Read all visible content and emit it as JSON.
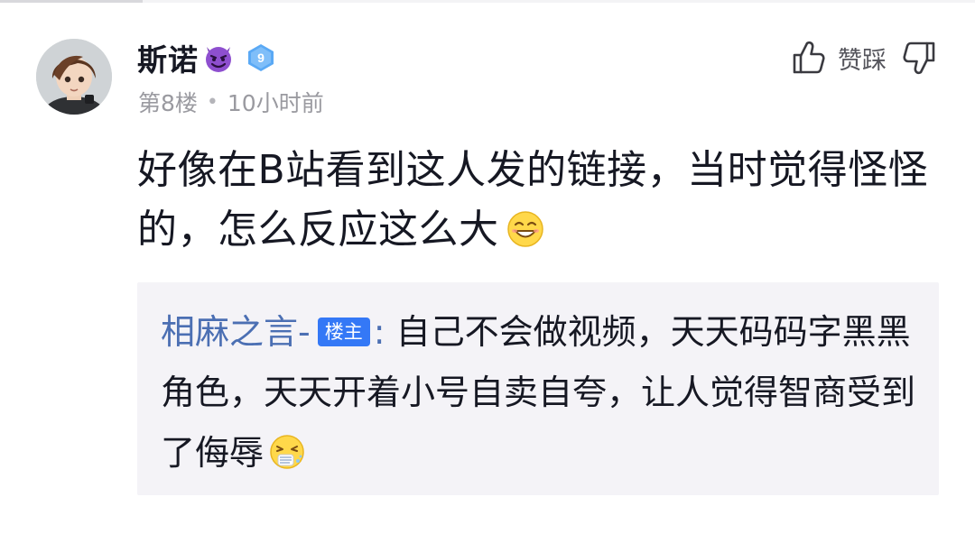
{
  "comment": {
    "username": "斯诺",
    "username_emoji": "devil-emoji-icon",
    "level": "9",
    "floor": "第8楼",
    "separator": "•",
    "time": "10小时前",
    "text": "好像在B站看到这人发的链接，当时觉得怪怪的，怎么反应这么大",
    "text_emoji": "laughing-emoji-icon"
  },
  "actions": {
    "like_icon": "thumbs-up-icon",
    "label": "赞踩",
    "dislike_icon": "thumbs-down-icon"
  },
  "reply": {
    "username": "相麻之言-",
    "owner_badge": "楼主",
    "colon": ":",
    "text": " 自己不会做视频，天天码码字黑黑角色，天天开着小号自卖自夸，让人觉得智商受到了侮辱",
    "text_emoji": "sneezing-emoji-icon"
  },
  "colors": {
    "accent": "#3478f6",
    "reply_user": "#4b6fb3",
    "reply_bg": "#f4f3f7",
    "meta": "#9a9aa0"
  }
}
